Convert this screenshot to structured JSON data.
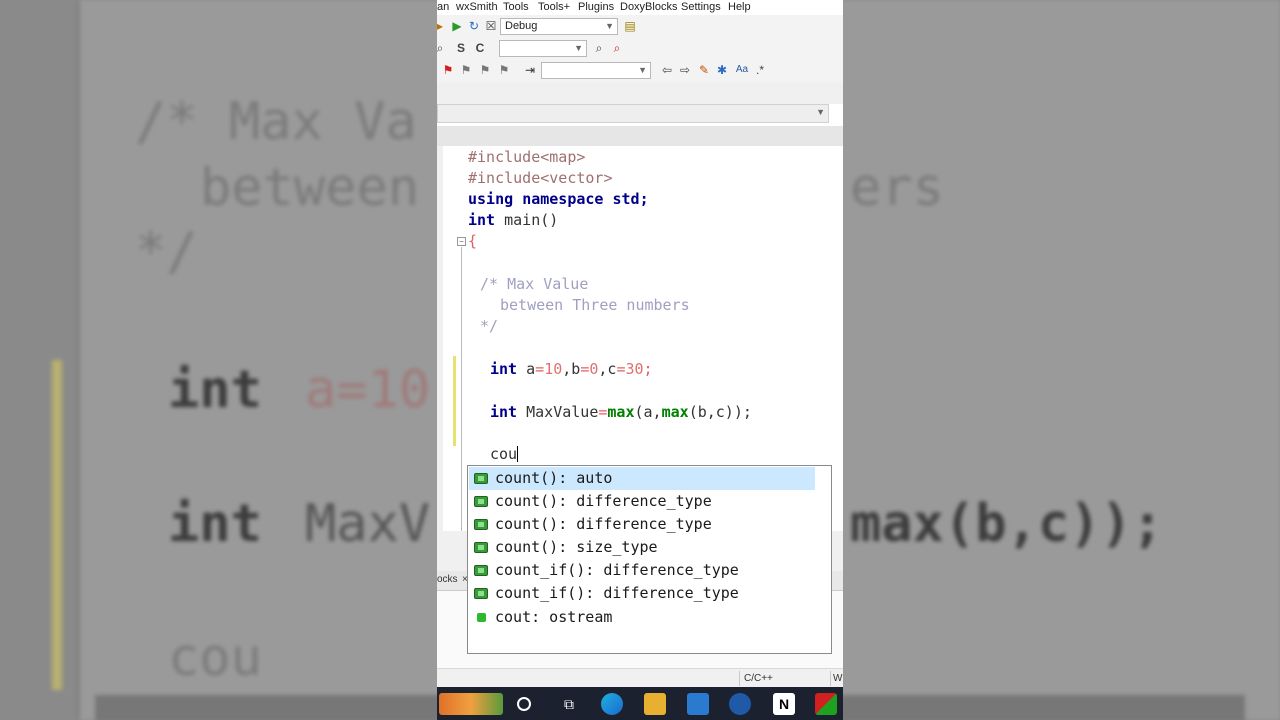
{
  "menu": [
    "an",
    "wxSmith",
    "Tools",
    "Tools+",
    "Plugins",
    "DoxyBlocks",
    "Settings",
    "Help"
  ],
  "toolbar": {
    "build_target": "Debug",
    "search_letters": [
      "S",
      "C"
    ]
  },
  "code_lines": {
    "l1": "#include<map>",
    "l2": "#include<vector>",
    "l3_kw1": "using",
    "l3_kw2": "namespace",
    "l3_rest": " std;",
    "l4_kw": "int",
    "l4_rest": " main()",
    "l5": "{",
    "c1": "/* Max Value",
    "c2": "between Three numbers",
    "c3": "*/",
    "v_kw": "int",
    "v_a": " a",
    "v_eq1": "=",
    "v_10": "10",
    "v_b": ",b",
    "v_eq2": "=",
    "v_0": "0",
    "v_c": ",c",
    "v_eq3": "=",
    "v_30": "30",
    "v_end": ";",
    "m_kw": "int",
    "m_name": " MaxValue",
    "m_eq": "=",
    "m_max1": "max",
    "m_mid": "(a,",
    "m_max2": "max",
    "m_end": "(b,c));",
    "typing": "cou"
  },
  "autocomplete": [
    {
      "text": "count(): auto",
      "selected": true,
      "icon": "function-icon"
    },
    {
      "text": "count(): difference_type",
      "selected": false,
      "icon": "function-icon"
    },
    {
      "text": "count(): difference_type",
      "selected": false,
      "icon": "function-icon"
    },
    {
      "text": "count(): size_type",
      "selected": false,
      "icon": "function-icon"
    },
    {
      "text": "count_if(): difference_type",
      "selected": false,
      "icon": "function-icon"
    },
    {
      "text": "count_if(): difference_type",
      "selected": false,
      "icon": "function-icon"
    },
    {
      "text": "cout: ostream",
      "selected": false,
      "icon": "variable-icon"
    }
  ],
  "lower_tab": "ocks",
  "status": {
    "language": "C/C++",
    "extra": "W"
  },
  "background": {
    "comment1": "/* Max Va",
    "comment2": "between",
    "comment2b": "ers",
    "comment3": "*/",
    "int1": "int",
    "a10": "a=10",
    "int2": "int",
    "maxv": "MaxV",
    "maxbc": "max(b,c));",
    "cou": "cou"
  },
  "colors": {
    "keyword": "#00008b",
    "preprocessor": "#a07070",
    "comment": "#a0a0c0",
    "number": "#e07070",
    "function": "#008000",
    "selection": "#cce8ff"
  }
}
